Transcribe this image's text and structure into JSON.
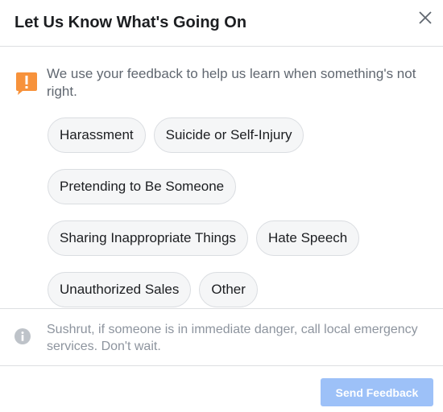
{
  "dialog": {
    "title": "Let Us Know What's Going On",
    "intro_text": "We use your feedback to help us learn when something's not right.",
    "options": [
      "Harassment",
      "Suicide or Self-Injury",
      "Pretending to Be Someone",
      "Sharing Inappropriate Things",
      "Hate Speech",
      "Unauthorized Sales",
      "Other"
    ],
    "info_text": "Sushrut, if someone is in immediate danger, call local emergency services. Don't wait.",
    "send_label": "Send Feedback"
  },
  "colors": {
    "alert_icon": "#f7923b",
    "button_disabled": "#9dc1f8",
    "chip_background": "#f5f6f7",
    "muted_text": "#8d949e"
  },
  "icons": {
    "close": "close-icon",
    "alert": "alert-icon",
    "info": "info-icon"
  }
}
